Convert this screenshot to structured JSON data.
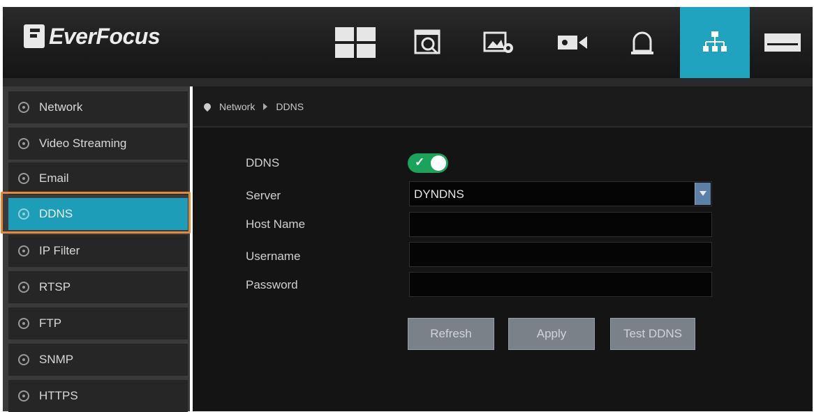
{
  "brand": {
    "name": "EverFocus"
  },
  "top_nav": {
    "items": [
      {
        "icon": "layout-grid-icon"
      },
      {
        "icon": "playback-search-icon"
      },
      {
        "icon": "image-settings-icon"
      },
      {
        "icon": "camera-icon"
      },
      {
        "icon": "alarm-bell-icon"
      },
      {
        "icon": "network-icon",
        "active": true
      },
      {
        "icon": "hdd-icon"
      }
    ]
  },
  "sidebar": {
    "items": [
      {
        "label": "Network"
      },
      {
        "label": "Video Streaming"
      },
      {
        "label": "Email"
      },
      {
        "label": "DDNS",
        "selected": true
      },
      {
        "label": "IP Filter"
      },
      {
        "label": "RTSP"
      },
      {
        "label": "FTP"
      },
      {
        "label": "SNMP"
      },
      {
        "label": "HTTPS"
      }
    ]
  },
  "breadcrumb": {
    "parent": "Network",
    "current": "DDNS"
  },
  "form": {
    "ddns_label": "DDNS",
    "ddns_enabled": true,
    "server_label": "Server",
    "server_value": "DYNDNS",
    "host_label": "Host Name",
    "host_value": "",
    "username_label": "Username",
    "username_value": "",
    "password_label": "Password",
    "password_value": ""
  },
  "buttons": {
    "refresh": "Refresh",
    "apply": "Apply",
    "test": "Test DDNS"
  },
  "colors": {
    "accent": "#1fa3bf",
    "toggle_on": "#19a35b",
    "highlight": "#e5893b"
  }
}
